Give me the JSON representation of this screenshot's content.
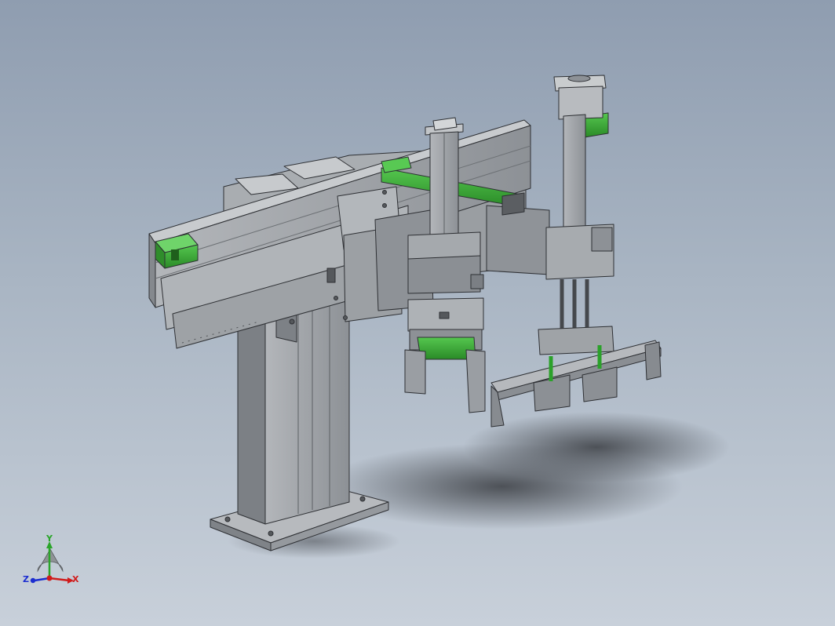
{
  "viewport": {
    "background_top": "#8f9db0",
    "background_bottom": "#c8d0da",
    "model_color": "#9a9ea3",
    "accent_color": "#3fae3b"
  },
  "triad": {
    "x_label": "X",
    "y_label": "Y",
    "z_label": "Z",
    "x_color": "#d01c1c",
    "y_color": "#2aa52a",
    "z_color": "#1c2ed0"
  }
}
